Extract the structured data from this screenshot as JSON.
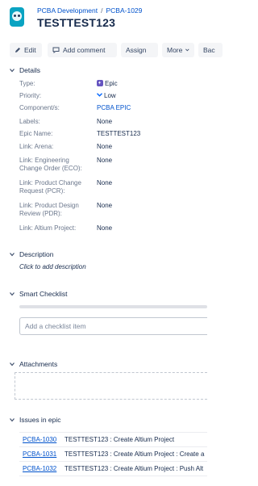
{
  "breadcrumb": {
    "project": "PCBA Development",
    "issue_key": "PCBA-1029"
  },
  "title": "TESTTEST123",
  "toolbar": {
    "edit": "Edit",
    "comment": "Add comment",
    "assign": "Assign",
    "more": "More",
    "next": "Bac"
  },
  "details": {
    "heading": "Details",
    "fields": [
      {
        "label": "Type:",
        "value": "Epic"
      },
      {
        "label": "Priority:",
        "value": "Low"
      },
      {
        "label": "Component/s:",
        "value": "PCBA EPIC"
      },
      {
        "label": "Labels:",
        "value": "None"
      },
      {
        "label": "Epic Name:",
        "value": "TESTTEST123"
      },
      {
        "label": "Link: Arena:",
        "value": "None"
      },
      {
        "label": "Link: Engineering Change Order (ECO):",
        "value": "None"
      },
      {
        "label": "Link: Product Change Request (PCR):",
        "value": "None"
      },
      {
        "label": "Link: Product Design Review (PDR):",
        "value": "None"
      },
      {
        "label": "Link: Altium Project:",
        "value": "None"
      }
    ]
  },
  "description": {
    "heading": "Description",
    "hint": "Click to add description"
  },
  "smart_checklist": {
    "heading": "Smart Checklist",
    "placeholder": "Add a checklist item"
  },
  "attachments": {
    "heading": "Attachments"
  },
  "issues_in_epic": {
    "heading": "Issues in epic",
    "items": [
      {
        "key": "PCBA-1030",
        "summary": "TESTTEST123 : Create Altium Project"
      },
      {
        "key": "PCBA-1031",
        "summary": "TESTTEST123 : Create Altium Project : Create a"
      },
      {
        "key": "PCBA-1032",
        "summary": "TESTTEST123 : Create Altium Project : Push Alt"
      }
    ]
  },
  "colors": {
    "link": "#0052cc",
    "epic": "#6554c0",
    "priority_low": "#0065ff",
    "text": "#172b4d",
    "muted": "#6b778c"
  }
}
